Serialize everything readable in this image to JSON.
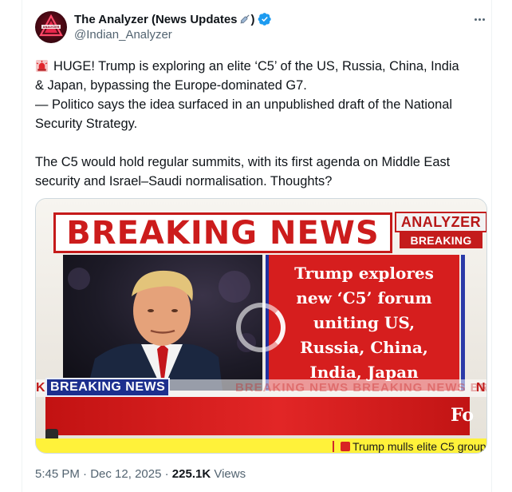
{
  "author": {
    "display_name": "The Analyzer (News Updates",
    "display_name_suffix": ")",
    "handle": "@Indian_Analyzer",
    "avatar_text": "ANALYZER"
  },
  "tweet": {
    "paragraph1_line1": "HUGE! Trump is exploring an elite ‘C5’ of the US, Russia, China, India",
    "paragraph1_line2": "& Japan, bypassing the Europe-dominated G7.",
    "paragraph1_line3": "— Politico says the idea surfaced in an unpublished draft of the National",
    "paragraph1_line4": "Security Strategy.",
    "paragraph2_line1": "The C5 would hold regular summits, with its first agenda on Middle East",
    "paragraph2_line2": "security and Israel–Saudi normalisation. Thoughts?"
  },
  "media": {
    "banner": "BREAKING NEWS",
    "brand_top": "ANALYZER",
    "brand_bottom": "BREAKING",
    "headline_lines": [
      "Trump explores",
      "new ‘C5’ forum",
      "uniting US,",
      "Russia, China,",
      "India, Japan"
    ],
    "badge": "BREAKING NEWS",
    "ghost_ticker": "BREAKING NEWS    BREAKING NEWS    BREAKING NEWS    BREAKING NEWS",
    "ticker_k": "K",
    "ticker_n": "N",
    "lower_third": "Fo",
    "yellow_ticker": "Trump mulls elite C5 group"
  },
  "meta": {
    "time": "5:45 PM",
    "date": "Dec 12, 2025",
    "views_count": "225.1K",
    "views_label": "Views"
  },
  "colors": {
    "verified": "#1d9bf0",
    "breaking_red": "#cc1c1c",
    "text_secondary": "#536471"
  }
}
